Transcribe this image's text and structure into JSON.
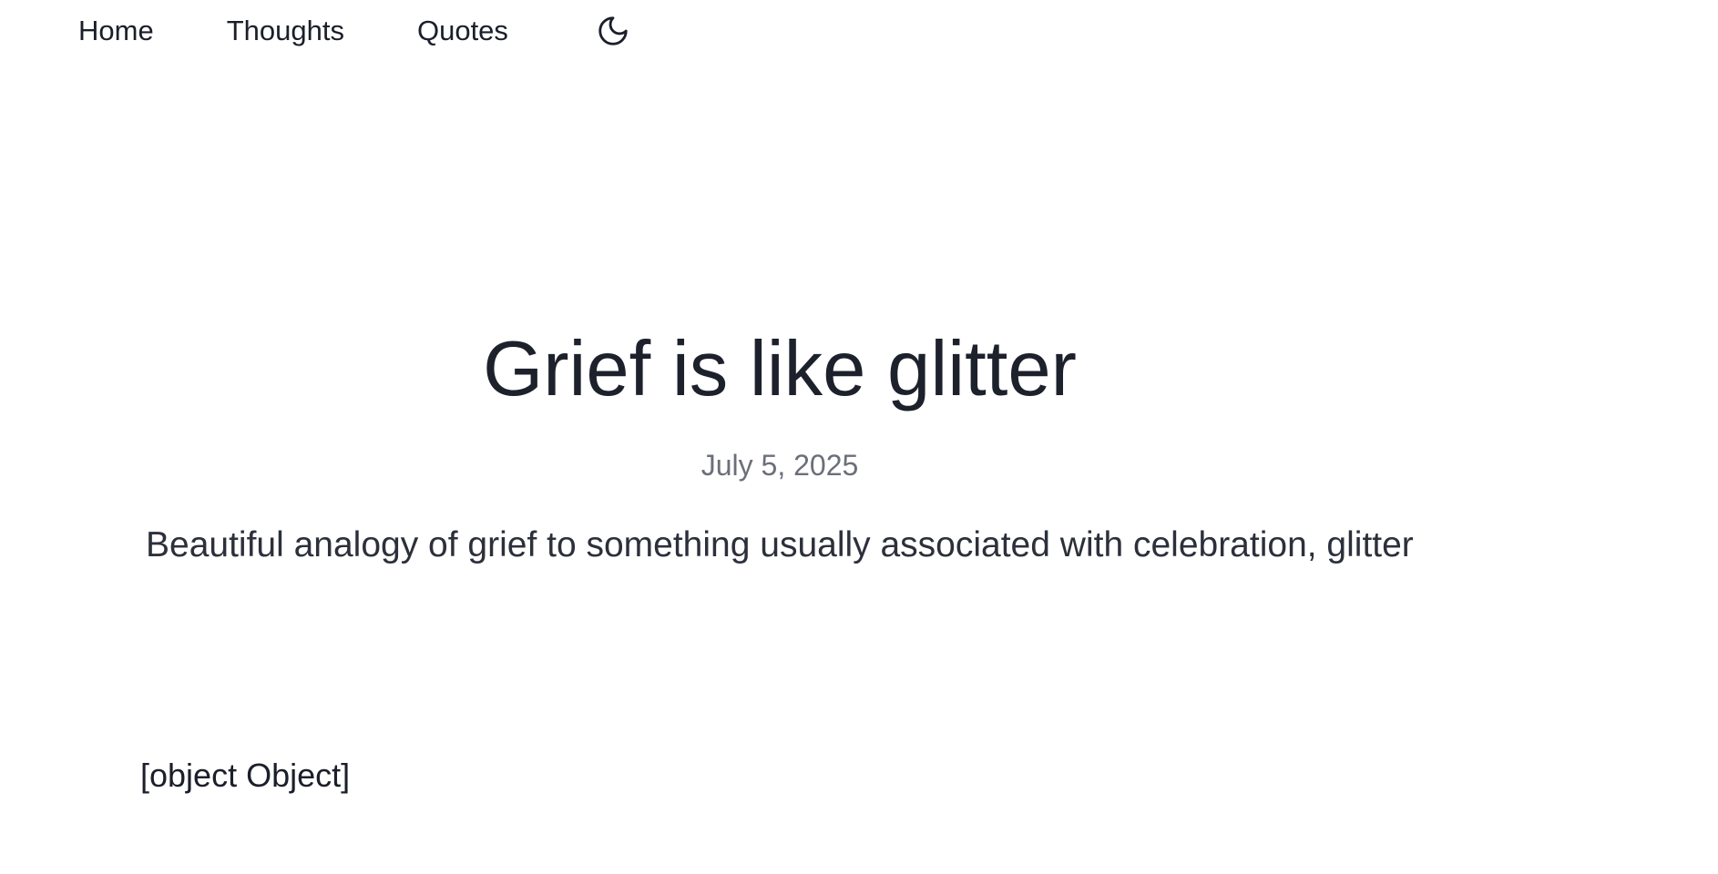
{
  "nav": {
    "items": [
      {
        "label": "Home"
      },
      {
        "label": "Thoughts"
      },
      {
        "label": "Quotes"
      }
    ],
    "theme_toggle_icon": "moon-icon"
  },
  "post": {
    "title": "Grief is like glitter",
    "date": "July 5, 2025",
    "summary": "Beautiful analogy of grief to something usually associated with celebration, glitter",
    "body": "[object Object]"
  },
  "colors": {
    "background": "#ffffff",
    "text": "#1d212c",
    "muted": "#6b6f79"
  }
}
